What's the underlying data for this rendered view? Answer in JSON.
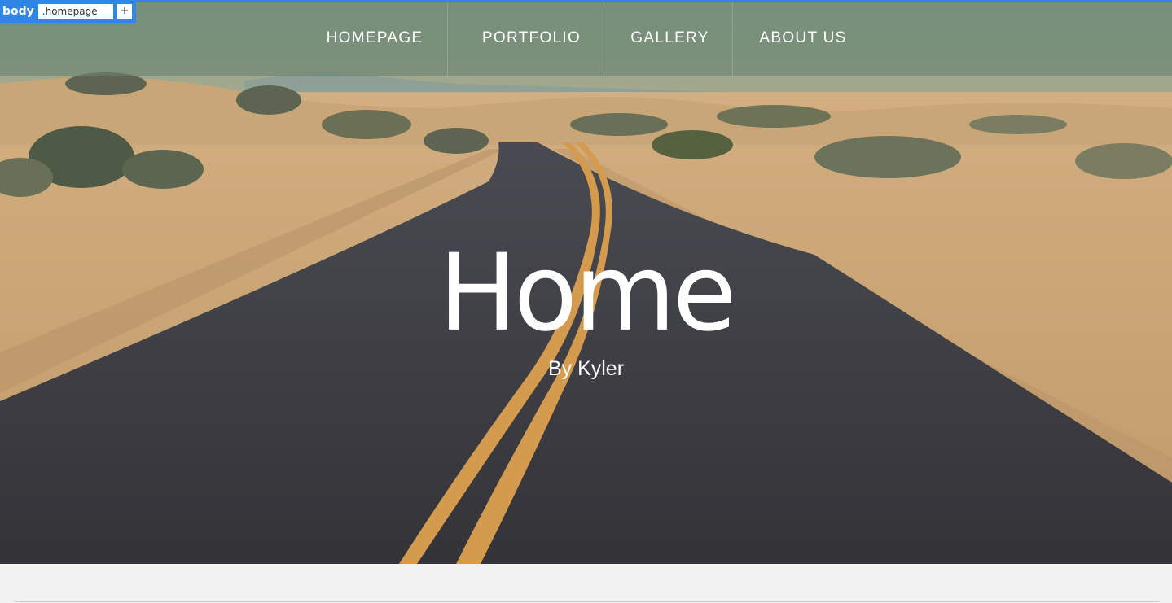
{
  "editor": {
    "tag": "body",
    "class_value": ".homepage",
    "add_label": "+"
  },
  "nav": {
    "items": [
      {
        "label": "HOMEPAGE"
      },
      {
        "label": "PORTFOLIO"
      },
      {
        "label": "GALLERY"
      },
      {
        "label": "ABOUT US"
      }
    ]
  },
  "hero": {
    "title": "Home",
    "subtitle": "By Kyler"
  },
  "colors": {
    "editor_accent": "#2f86e4",
    "nav_overlay": "#68826e",
    "sand": "#c9a578",
    "road": "#3a3a40",
    "road_line": "#d49a4e",
    "footer_bg": "#f2f2f2"
  }
}
